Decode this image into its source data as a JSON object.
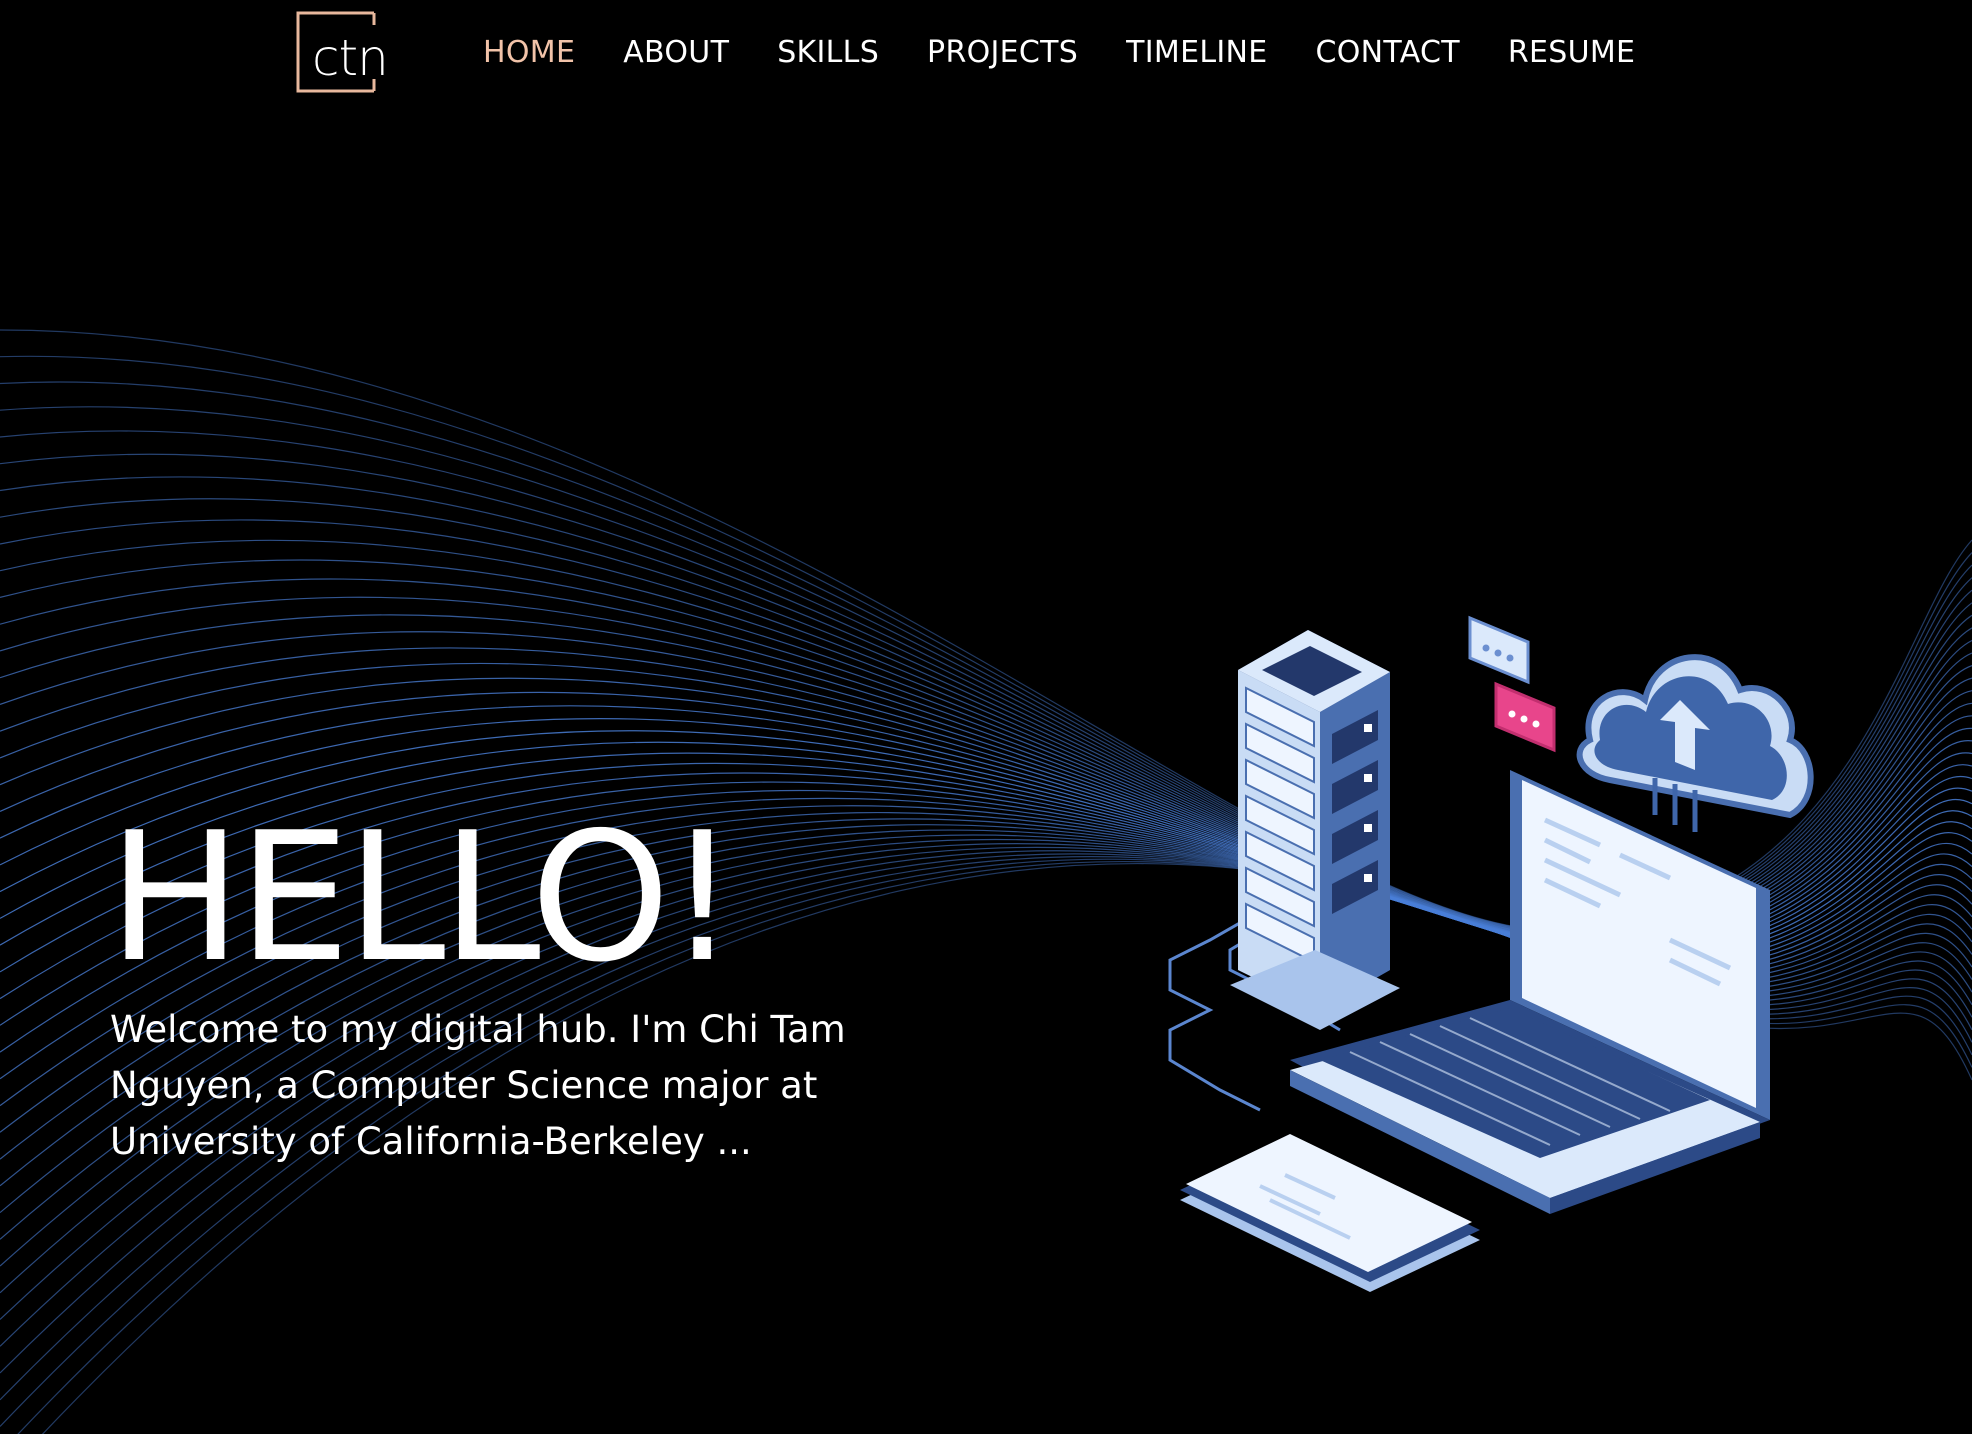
{
  "logo": {
    "text": "ctn",
    "color": "#e8b89d"
  },
  "nav": {
    "items": [
      {
        "label": "HOME",
        "active": true
      },
      {
        "label": "ABOUT",
        "active": false
      },
      {
        "label": "SKILLS",
        "active": false
      },
      {
        "label": "PROJECTS",
        "active": false
      },
      {
        "label": "TIMELINE",
        "active": false
      },
      {
        "label": "CONTACT",
        "active": false
      },
      {
        "label": "RESUME",
        "active": false
      }
    ],
    "active_color": "#f2c3a9",
    "text_color": "#ffffff"
  },
  "hero": {
    "title": "HELLO!",
    "intro": "Welcome to my digital hub. I'm Chi Tam Nguyen, a Computer Science major at University of California-Berkeley ..."
  },
  "illustration": {
    "icons": [
      "server-rack-icon",
      "cloud-upload-icon",
      "laptop-icon",
      "tablet-icon",
      "chat-bubble-icon"
    ]
  },
  "colors": {
    "background": "#000000",
    "wave": "#4a7fd8",
    "device_light": "#dbe9fb",
    "device_dark": "#2c4a87",
    "accent_pink": "#e8458b"
  }
}
